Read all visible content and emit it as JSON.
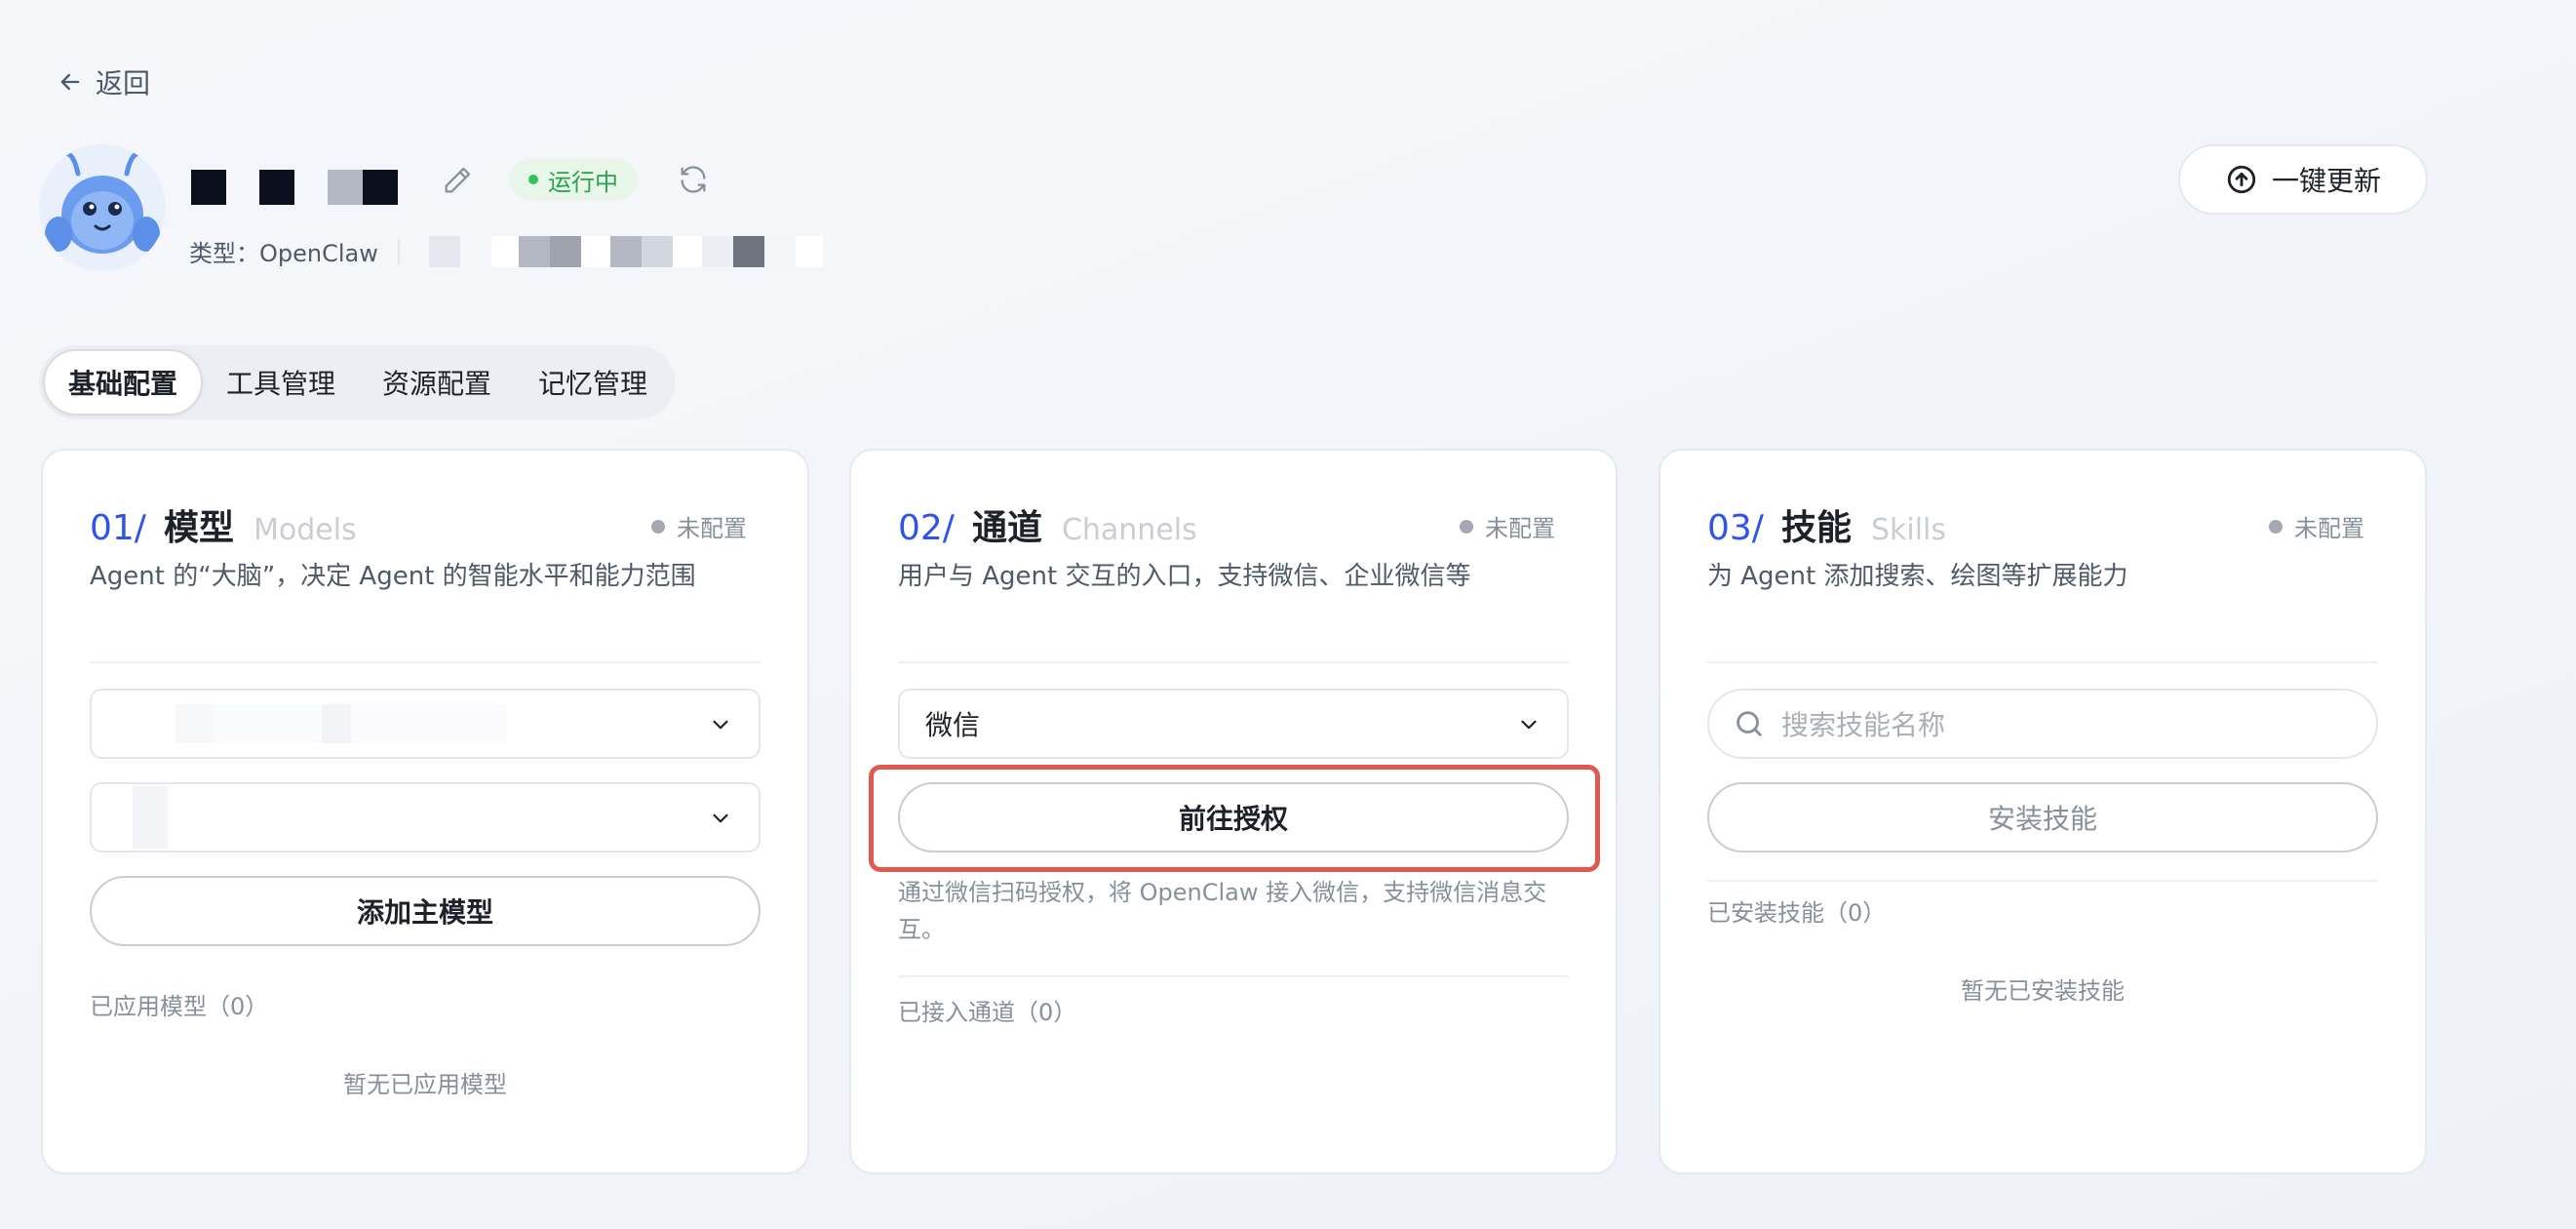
{
  "nav": {
    "back_label": "返回"
  },
  "agent": {
    "status": "运行中",
    "type_label": "类型：OpenClaw"
  },
  "header": {
    "update_label": "一键更新"
  },
  "tabs": [
    {
      "label": "基础配置",
      "active": true
    },
    {
      "label": "工具管理",
      "active": false
    },
    {
      "label": "资源配置",
      "active": false
    },
    {
      "label": "记忆管理",
      "active": false
    }
  ],
  "cards": {
    "models": {
      "num": "01/",
      "title": "模型",
      "en": "Models",
      "status": "未配置",
      "desc": "Agent 的“大脑”，决定 Agent 的智能水平和能力范围",
      "add_label": "添加主模型",
      "applied_label": "已应用模型（0）",
      "empty_label": "暂无已应用模型"
    },
    "channels": {
      "num": "02/",
      "title": "通道",
      "en": "Channels",
      "status": "未配置",
      "desc": "用户与 Agent 交互的入口，支持微信、企业微信等",
      "select_value": "微信",
      "auth_label": "前往授权",
      "hint_line1": "通过微信扫码授权，将 OpenClaw 接入微信，支持微信消息交",
      "hint_line2": "互。",
      "connected_label": "已接入通道（0）"
    },
    "skills": {
      "num": "03/",
      "title": "技能",
      "en": "Skills",
      "status": "未配置",
      "desc": "为 Agent 添加搜索、绘图等扩展能力",
      "search_placeholder": "搜索技能名称",
      "install_label": "安装技能",
      "installed_label": "已安装技能（0）",
      "empty_label": "暂无已安装技能"
    }
  },
  "colors": {
    "accent_blue": "#2f54eb",
    "status_green": "#2aa34a",
    "highlight_red": "#e0584e"
  }
}
